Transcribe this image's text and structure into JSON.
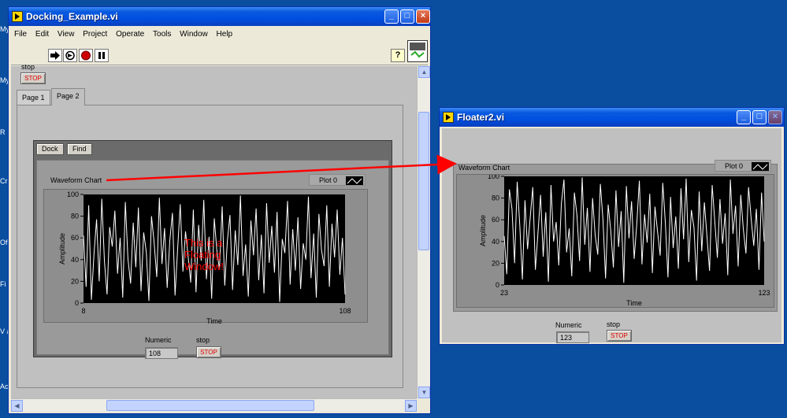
{
  "desktop": {
    "labels": [
      "My",
      "My",
      "R",
      "Cr",
      "Of",
      "Fi",
      "V a",
      "Ac"
    ]
  },
  "main_window": {
    "title": "Docking_Example.vi",
    "menu": [
      "File",
      "Edit",
      "View",
      "Project",
      "Operate",
      "Tools",
      "Window",
      "Help"
    ],
    "toolbar": {
      "run": "run-arrow-icon",
      "run_continuous": "run-continuously-icon",
      "abort": "abort-execution-icon",
      "pause": "pause-icon",
      "help": "?",
      "vi_icon": "vi-connector-icon"
    },
    "stop_label": "stop",
    "stop_button": "STOP",
    "tabs": [
      "Page 1",
      "Page 2"
    ],
    "active_tab": "Page 2",
    "subpanel": {
      "dock_button": "Dock",
      "find_button": "Find",
      "chart_title": "Waveform Chart",
      "legend": "Plot 0",
      "annotation": "This is a Floating Window!",
      "numeric_label": "Numeric",
      "numeric_value": "108",
      "stop_label": "stop",
      "stop_button": "STOP"
    }
  },
  "float_window": {
    "title": "Floater2.vi",
    "chart_title": "Waveform Chart",
    "legend": "Plot 0",
    "numeric_label": "Numeric",
    "numeric_value": "123",
    "stop_label": "stop",
    "stop_button": "STOP"
  },
  "colors": {
    "annotation": "#ff0000",
    "arrow": "#ff0000",
    "plot_bg": "#000000",
    "trace": "#ffffff"
  },
  "chart_data": [
    {
      "type": "line",
      "title": "Waveform Chart",
      "xlabel": "Time",
      "ylabel": "Amplitude",
      "xlim": [
        8,
        108
      ],
      "ylim": [
        0,
        100
      ],
      "x_ticks": [
        "8",
        "108"
      ],
      "y_ticks": [
        "0",
        "20",
        "40",
        "60",
        "80",
        "100"
      ],
      "legend": "top-right",
      "series": [
        {
          "name": "Plot 0",
          "values": [
            62,
            15,
            90,
            3,
            45,
            77,
            20,
            96,
            38,
            8,
            70,
            52,
            85,
            27,
            60,
            5,
            93,
            41,
            18,
            74,
            33,
            88,
            11,
            65,
            47,
            2,
            80,
            56,
            24,
            97,
            36,
            69,
            14,
            58,
            83,
            7,
            50,
            91,
            29,
            66,
            43,
            19,
            86,
            10,
            72,
            39,
            95,
            22,
            61,
            4,
            78,
            48,
            31,
            89,
            16,
            57,
            81,
            12,
            67,
            35,
            99,
            25,
            54,
            6,
            76,
            44,
            87,
            21,
            63,
            9,
            92,
            37,
            71,
            28,
            84,
            1,
            59,
            46,
            94,
            17,
            68,
            30,
            79,
            13,
            55,
            40,
            98,
            23,
            64,
            5,
            82,
            49,
            34,
            90,
            15,
            73,
            42,
            86,
            26,
            60,
            8
          ]
        }
      ]
    },
    {
      "type": "line",
      "title": "Waveform Chart",
      "xlabel": "Time",
      "ylabel": "Amplitude",
      "xlim": [
        23,
        123
      ],
      "ylim": [
        0,
        100
      ],
      "x_ticks": [
        "23",
        "123"
      ],
      "y_ticks": [
        "0",
        "20",
        "40",
        "60",
        "80",
        "100"
      ],
      "legend": "top-right",
      "series": [
        {
          "name": "Plot 0",
          "values": [
            45,
            10,
            88,
            70,
            20,
            95,
            55,
            5,
            78,
            33,
            62,
            90,
            14,
            48,
            83,
            26,
            67,
            3,
            92,
            40,
            58,
            18,
            75,
            97,
            30,
            52,
            8,
            85,
            64,
            22,
            99,
            37,
            71,
            12,
            80,
            46,
            28,
            93,
            60,
            6,
            74,
            50,
            16,
            87,
            35,
            68,
            2,
            91,
            43,
            77,
            24,
            56,
            96,
            19,
            65,
            39,
            84,
            11,
            72,
            49,
            27,
            94,
            57,
            7,
            81,
            34,
            63,
            15,
            89,
            42,
            98,
            21,
            69,
            53,
            4,
            86,
            31,
            76,
            45,
            13,
            92,
            59,
            25,
            79,
            38,
            66,
            9,
            97,
            47,
            73,
            17,
            83,
            51,
            29,
            90,
            61,
            36,
            70,
            14,
            85,
            40
          ]
        }
      ]
    }
  ]
}
